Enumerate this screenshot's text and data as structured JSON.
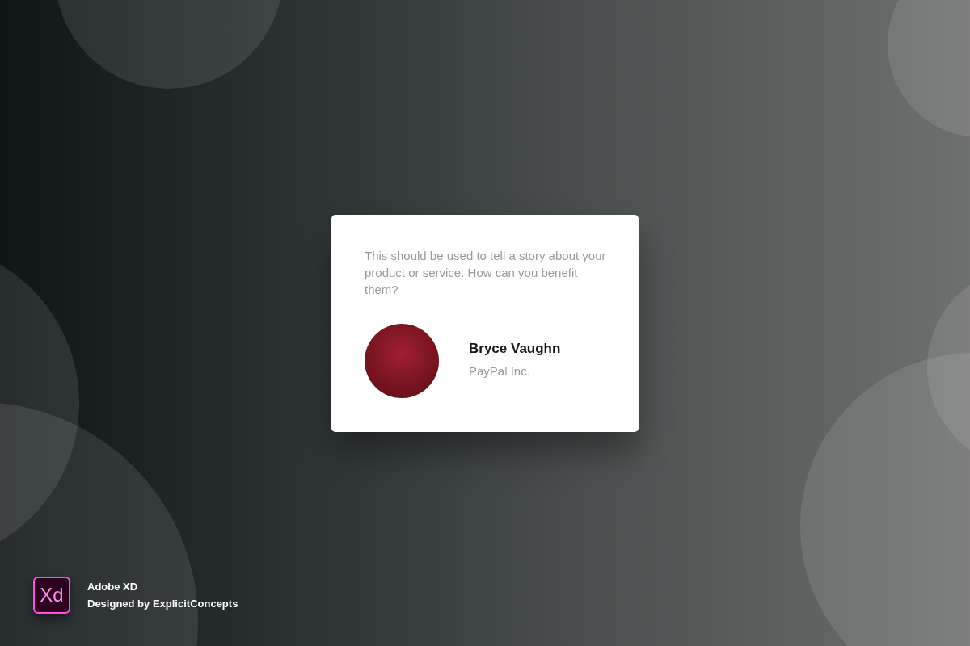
{
  "testimonial": {
    "quote": "This should be used to tell a story about your product or service. How can you benefit them?",
    "author": {
      "name": "Bryce Vaughn",
      "company": "PayPal Inc."
    }
  },
  "credit": {
    "logo_text": "Xd",
    "app": "Adobe XD",
    "designer": "Designed by ExplicitConcepts"
  }
}
